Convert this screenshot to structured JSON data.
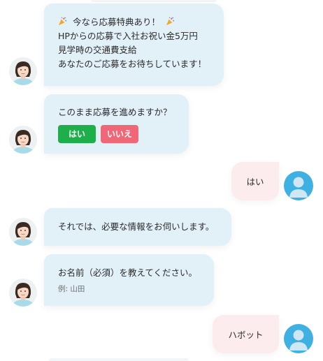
{
  "messages": {
    "intro": {
      "line1": "今なら応募特典あり！",
      "line2": "HPからの応募で入社お祝い金5万円",
      "line3": "見学時の交通費支給",
      "line4": "あなたのご応募をお待ちしています！"
    },
    "confirm": {
      "text": "このまま応募を進めますか？",
      "yes_label": "はい",
      "no_label": "いいえ"
    },
    "user_reply_1": "はい",
    "request_info": "それでは、必要な情報をお伺いします。",
    "name_prompt": {
      "text": "お名前（必須）を教えてください。",
      "hint": "例: 山田"
    },
    "user_reply_2": "ハボット"
  },
  "icons": {
    "party": "party-popper-icon",
    "bot_avatar": "bot-avatar",
    "user_avatar": "user-avatar-icon"
  },
  "colors": {
    "bot_bubble": "#e2f0f8",
    "user_bubble": "#fdeced",
    "yes_button": "#1db04a",
    "no_button": "#f06878",
    "user_avatar": "#3fb0e2"
  }
}
